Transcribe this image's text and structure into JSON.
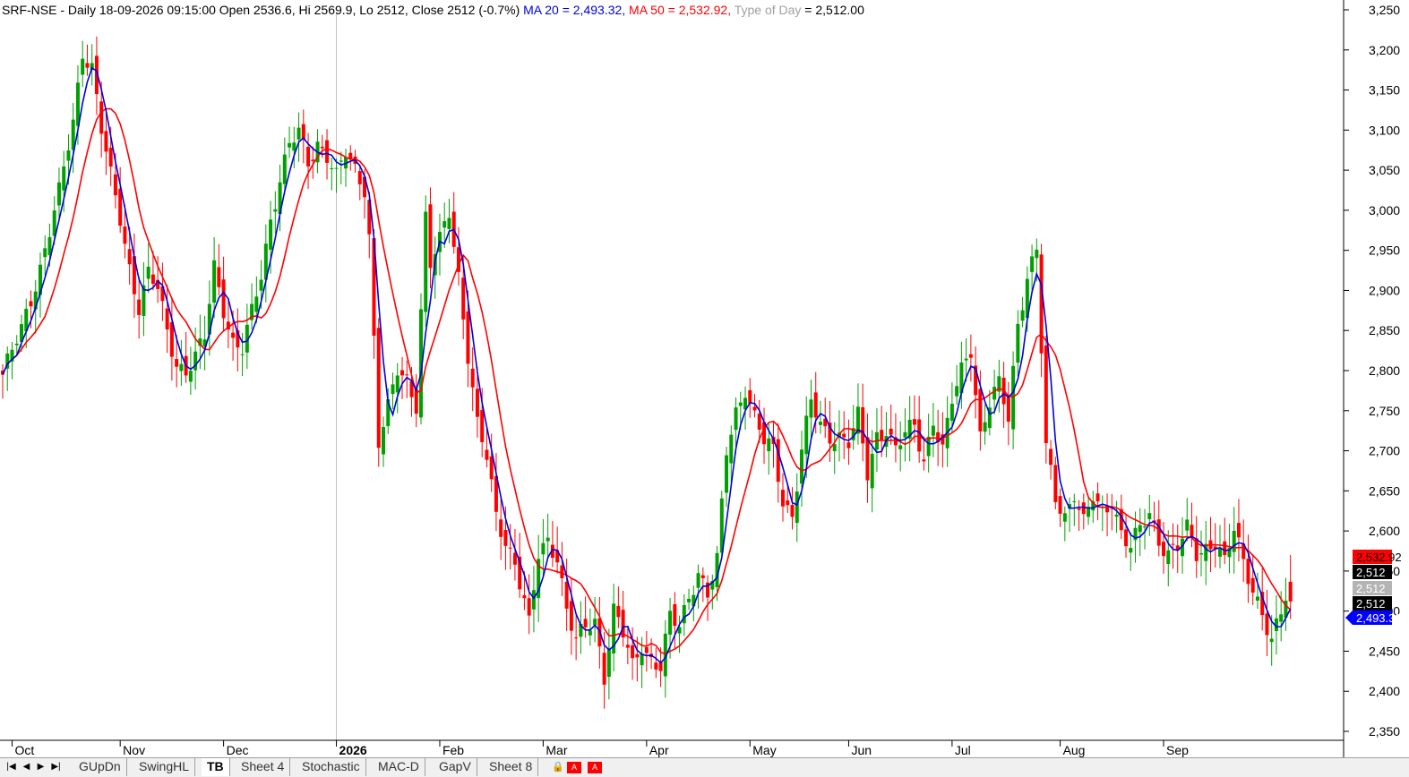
{
  "header": {
    "symbol": "SRF-NSE",
    "info": "SRF-NSE - Daily 18-09-2026 09:15:00 Open 2536.6, Hi 2569.9, Lo 2512, Close 2512 (-0.7%)",
    "ma20": "MA 20 = 2,493.32,",
    "ma50": "MA 50 = 2,532.92,",
    "tod_label": "Type of Day",
    "tod_value": " = 2,512.00"
  },
  "colors": {
    "up": "#00a000",
    "down": "#ff0000",
    "ma20": "#0000e0",
    "ma50": "#ff0000",
    "grid": "#d8d8d8"
  },
  "chart_data": {
    "type": "candlestick",
    "ylim": [
      2350,
      3250
    ],
    "y_ticks": [
      "2,350",
      "2,400",
      "2,450",
      "2,500",
      "2,550",
      "2,600",
      "2,650",
      "2,700",
      "2,750",
      "2,800",
      "2,850",
      "2,900",
      "2,950",
      "3,000",
      "3,050",
      "3,100",
      "3,150",
      "3,200",
      "3,250"
    ],
    "x_labels": [
      "Oct",
      "Nov",
      "Dec",
      "2026",
      "Feb",
      "Mar",
      "Apr",
      "May",
      "Jun",
      "Jul",
      "Aug",
      "Sep"
    ],
    "last": {
      "open": 2536.6,
      "high": 2569.9,
      "low": 2512,
      "close": 2512
    },
    "price_tags": [
      {
        "text": "2,532.92",
        "bg": "#ff0000",
        "fg": "#000000"
      },
      {
        "text": "2,512",
        "bg": "#000000",
        "fg": "#ffffff"
      },
      {
        "text": "2,512",
        "bg": "#b4b4b4",
        "fg": "#ffffff"
      },
      {
        "text": "2,512",
        "bg": "#000000",
        "fg": "#ffffff"
      },
      {
        "text": "2,493.32",
        "bg": "#0000ff",
        "fg": "#ffffff"
      }
    ],
    "close_anchors": [
      [
        0,
        2795
      ],
      [
        4,
        2850
      ],
      [
        8,
        2930
      ],
      [
        12,
        3020
      ],
      [
        15,
        3110
      ],
      [
        17,
        3200
      ],
      [
        19,
        3180
      ],
      [
        21,
        3100
      ],
      [
        23,
        3040
      ],
      [
        25,
        2990
      ],
      [
        27,
        2930
      ],
      [
        29,
        2880
      ],
      [
        31,
        2920
      ],
      [
        33,
        2900
      ],
      [
        35,
        2850
      ],
      [
        37,
        2810
      ],
      [
        39,
        2800
      ],
      [
        41,
        2815
      ],
      [
        43,
        2840
      ],
      [
        45,
        2930
      ],
      [
        47,
        2880
      ],
      [
        49,
        2835
      ],
      [
        51,
        2825
      ],
      [
        53,
        2870
      ],
      [
        55,
        2920
      ],
      [
        57,
        2990
      ],
      [
        59,
        3040
      ],
      [
        61,
        3080
      ],
      [
        63,
        3095
      ],
      [
        65,
        3060
      ],
      [
        67,
        3085
      ],
      [
        69,
        3070
      ],
      [
        71,
        3040
      ],
      [
        73,
        3070
      ],
      [
        75,
        3050
      ],
      [
        77,
        3030
      ],
      [
        78,
        2970
      ],
      [
        80,
        2710
      ],
      [
        82,
        2750
      ],
      [
        84,
        2800
      ],
      [
        86,
        2790
      ],
      [
        88,
        2760
      ],
      [
        90,
        2990
      ],
      [
        91,
        2930
      ],
      [
        93,
        2960
      ],
      [
        95,
        3000
      ],
      [
        97,
        2920
      ],
      [
        99,
        2820
      ],
      [
        101,
        2730
      ],
      [
        103,
        2690
      ],
      [
        105,
        2620
      ],
      [
        107,
        2590
      ],
      [
        109,
        2560
      ],
      [
        111,
        2510
      ],
      [
        112,
        2480
      ],
      [
        114,
        2570
      ],
      [
        116,
        2590
      ],
      [
        118,
        2570
      ],
      [
        120,
        2500
      ],
      [
        122,
        2460
      ],
      [
        124,
        2480
      ],
      [
        126,
        2490
      ],
      [
        128,
        2420
      ],
      [
        130,
        2500
      ],
      [
        132,
        2470
      ],
      [
        134,
        2430
      ],
      [
        136,
        2460
      ],
      [
        138,
        2440
      ],
      [
        140,
        2430
      ],
      [
        142,
        2490
      ],
      [
        144,
        2480
      ],
      [
        146,
        2520
      ],
      [
        148,
        2550
      ],
      [
        150,
        2520
      ],
      [
        152,
        2560
      ],
      [
        154,
        2700
      ],
      [
        156,
        2750
      ],
      [
        158,
        2780
      ],
      [
        160,
        2740
      ],
      [
        162,
        2710
      ],
      [
        164,
        2700
      ],
      [
        166,
        2640
      ],
      [
        168,
        2620
      ],
      [
        170,
        2700
      ],
      [
        172,
        2760
      ],
      [
        174,
        2730
      ],
      [
        176,
        2720
      ],
      [
        178,
        2720
      ],
      [
        180,
        2710
      ],
      [
        182,
        2740
      ],
      [
        184,
        2670
      ],
      [
        186,
        2720
      ],
      [
        188,
        2730
      ],
      [
        190,
        2700
      ],
      [
        192,
        2720
      ],
      [
        194,
        2730
      ],
      [
        196,
        2690
      ],
      [
        198,
        2740
      ],
      [
        200,
        2700
      ],
      [
        202,
        2760
      ],
      [
        204,
        2800
      ],
      [
        206,
        2830
      ],
      [
        208,
        2720
      ],
      [
        210,
        2760
      ],
      [
        212,
        2780
      ],
      [
        214,
        2740
      ],
      [
        216,
        2860
      ],
      [
        218,
        2920
      ],
      [
        220,
        2950
      ],
      [
        222,
        2700
      ],
      [
        224,
        2640
      ],
      [
        226,
        2620
      ],
      [
        228,
        2650
      ],
      [
        230,
        2610
      ],
      [
        232,
        2640
      ],
      [
        234,
        2620
      ],
      [
        236,
        2640
      ],
      [
        238,
        2600
      ],
      [
        240,
        2580
      ],
      [
        242,
        2600
      ],
      [
        244,
        2620
      ],
      [
        246,
        2590
      ],
      [
        248,
        2575
      ],
      [
        250,
        2580
      ],
      [
        252,
        2600
      ],
      [
        254,
        2570
      ],
      [
        256,
        2580
      ],
      [
        258,
        2590
      ],
      [
        260,
        2560
      ],
      [
        262,
        2600
      ],
      [
        264,
        2560
      ],
      [
        266,
        2530
      ],
      [
        268,
        2500
      ],
      [
        270,
        2460
      ],
      [
        272,
        2495
      ],
      [
        274,
        2536
      ]
    ]
  },
  "tabs": {
    "items": [
      "GUpDn",
      "SwingHL",
      "TB",
      "Sheet 4",
      "Stochastic",
      "MAC-D",
      "GapV",
      "Sheet 8"
    ],
    "active": "TB",
    "nav": [
      "◀",
      "◀",
      "▶",
      "▶"
    ]
  }
}
